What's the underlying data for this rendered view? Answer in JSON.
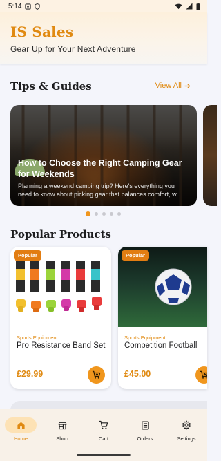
{
  "status_bar": {
    "time": "5:14"
  },
  "header": {
    "title": "IS Sales",
    "subtitle": "Gear Up for Your Next Adventure"
  },
  "tips": {
    "section_title": "Tips & Guides",
    "view_all": "View All",
    "card": {
      "title": "How to Choose the Right Camping Gear for Weekends",
      "description": "Planning a weekend camping trip? Here's everything you need to know about picking gear that balances comfort, w..."
    },
    "pager": {
      "count": 5,
      "active": 0
    }
  },
  "popular": {
    "section_title": "Popular Products",
    "products": [
      {
        "badge": "Popular",
        "category": "Sports Equipment",
        "name": "Pro Resistance Band Set",
        "price": "£29.99"
      },
      {
        "badge": "Popular",
        "category": "Sports Equipment",
        "name": "Competition Football",
        "price": "£45.00"
      }
    ]
  },
  "nav": {
    "items": [
      {
        "label": "Home",
        "icon": "home-icon",
        "active": true
      },
      {
        "label": "Shop",
        "icon": "store-icon",
        "active": false
      },
      {
        "label": "Cart",
        "icon": "cart-icon",
        "active": false
      },
      {
        "label": "Orders",
        "icon": "receipt-icon",
        "active": false
      },
      {
        "label": "Settings",
        "icon": "gear-icon",
        "active": false
      }
    ]
  },
  "colors": {
    "accent": "#e08a12",
    "accent_fill": "#f0961d",
    "badge": "#e27d12"
  }
}
